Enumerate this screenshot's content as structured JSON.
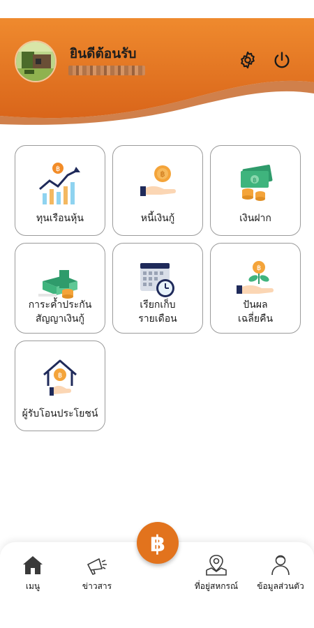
{
  "header": {
    "welcome_text": "ยินดีต้อนรับ",
    "brand_color": "#e6761e"
  },
  "menu": {
    "items": [
      {
        "label": "ทุนเรือนหุ้น",
        "icon": "share-capital-chart-icon"
      },
      {
        "label": "หนี้เงินกู้",
        "icon": "loan-coin-hand-icon"
      },
      {
        "label": "เงินฝาก",
        "icon": "deposit-money-icon"
      },
      {
        "label_line1": "การะค้ำประกัน",
        "label_line2": "สัญญาเงินกู้",
        "icon": "guarantee-money-stack-icon"
      },
      {
        "label_line1": "เรียกเก็บ",
        "label_line2": "รายเดือน",
        "icon": "calendar-clock-icon"
      },
      {
        "label_line1": "ปันผล",
        "label_line2": "เฉลี่ยคืน",
        "icon": "dividend-coin-plant-icon"
      },
      {
        "label": "ผู้รับโอนประโยชน์",
        "icon": "beneficiary-house-icon"
      }
    ]
  },
  "bottom_nav": {
    "items": [
      {
        "label": "เมนู",
        "icon": "home-icon"
      },
      {
        "label": "ข่าวสาร",
        "icon": "megaphone-icon"
      },
      {
        "label": "ที่อยู่สหกรณ์",
        "icon": "map-pin-icon"
      },
      {
        "label": "ข้อมูลส่วนตัว",
        "icon": "person-icon"
      }
    ],
    "center_icon": "baht-icon"
  }
}
